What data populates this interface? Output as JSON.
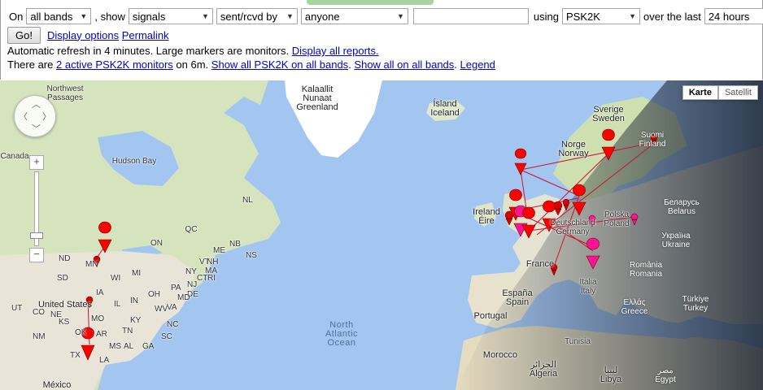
{
  "controls": {
    "on_label": "On",
    "band_select": "all bands",
    "show_label": ", show",
    "show_select": "signals",
    "direction_select": "sent/rcvd by",
    "who_select": "anyone",
    "callsign_value": "",
    "using_label": "using",
    "mode_select": "PSK2K",
    "over_label": "over the last",
    "period_select": "24 hours",
    "go_button": "Go!",
    "display_options_link": "Display options",
    "permalink_link": "Permalink"
  },
  "status": {
    "refresh_text": "Automatic refresh in 4 minutes. Large markers are monitors.",
    "display_all_link": "Display all reports.",
    "monitors_prefix": "There are",
    "monitors_link": "2 active PSK2K monitors",
    "monitors_suffix": "on 6m.",
    "show_all_mode_link": "Show all PSK2K on all bands",
    "show_all_link": "Show all on all bands",
    "legend_link": "Legend"
  },
  "map": {
    "type_map": "Karte",
    "type_satellite": "Satellit",
    "zoom_in": "+",
    "zoom_out": "−",
    "labels": {
      "greenland": "Kalaallit\nNunaat\nGreenland",
      "iceland": "Ísland\nIceland",
      "sweden": "Sverige\nSweden",
      "norway": "Norge\nNorway",
      "finland": "Suomi\nFinland",
      "hudson": "Hudson Bay",
      "canada": "Canada",
      "qc": "QC",
      "northwest": "Northwest\nPassages",
      "us": "United States",
      "atlantic": "North\nAtlantic\nOcean",
      "ireland": "Ireland\nÉire",
      "germany": "Deutschland\nGermany",
      "poland": "Polska\nPoland",
      "belarus": "Беларусь\nBelarus",
      "ukraine": "Україна\nUkraine",
      "france": "France",
      "italia": "Italia\nItaly",
      "romania": "România\nRomania",
      "espana": "España\nSpain",
      "portugal": "Portugal",
      "greece": "Ελλάς\nGreece",
      "turkey": "Türkiye\nTurkey",
      "morocco": "Morocco",
      "algeria": "الجزائر\nAlgeria",
      "tunisia": "Tunisia",
      "libya": "ليبيا\nLibya",
      "egypt": "مصر\nEgypt",
      "mexico": "México",
      "nd": "ND",
      "mn": "MN",
      "wi": "WI",
      "mi": "MI",
      "on": "ON",
      "ne": "NE",
      "ia": "IA",
      "ks": "KS",
      "mo": "MO",
      "ok": "OK",
      "tx": "TX",
      "nm": "NM",
      "ky": "KY",
      "va": "VA",
      "nc": "NC",
      "ga": "GA",
      "al": "AL",
      "ms": "MS",
      "tn": "TN",
      "oh": "OH",
      "in": "IN",
      "il": "IL",
      "pa": "PA",
      "ny": "NY",
      "me": "ME",
      "nb": "NB",
      "ns": "NS",
      "vt": "VT",
      "sc": "SC",
      "ar": "AR",
      "la": "LA",
      "sd": "SD",
      "wv": "WV",
      "de": "DE",
      "md": "MD",
      "nj": "NJ",
      "ct": "CT",
      "ri": "RI",
      "ma": "MA",
      "nh": "NH",
      "co": "CO",
      "ut": "UT",
      "nl": "NL"
    },
    "colors": {
      "ocean": "#a3c6f1",
      "land": "#e8e4d8",
      "forest": "#c9dcae",
      "marker_red": "#ff0000",
      "marker_pink": "#ff1493",
      "line": "#cc1133",
      "night": "#1b2433"
    }
  }
}
